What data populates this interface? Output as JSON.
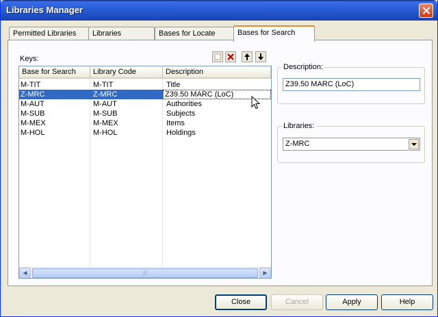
{
  "window": {
    "title": "Libraries Manager"
  },
  "tabs": [
    {
      "label": "Permitted Libraries",
      "active": false
    },
    {
      "label": "Libraries",
      "active": false
    },
    {
      "label": "Bases for Locate",
      "active": false
    },
    {
      "label": "Bases for Search",
      "active": true
    }
  ],
  "keys": {
    "label": "Keys:",
    "toolbar": [
      "new-icon",
      "delete-icon",
      "move-up-icon",
      "move-down-icon"
    ],
    "columns": [
      "Base for Search",
      "Library Code",
      "Description"
    ],
    "rows": [
      {
        "base": "M-TIT",
        "code": "M-TIT",
        "desc": "Title",
        "selected": false
      },
      {
        "base": "Z-MRC",
        "code": "Z-MRC",
        "desc": "Z39.50 MARC (LoC)",
        "selected": true
      },
      {
        "base": "M-AUT",
        "code": "M-AUT",
        "desc": "Authorities",
        "selected": false
      },
      {
        "base": "M-SUB",
        "code": "M-SUB",
        "desc": "Subjects",
        "selected": false
      },
      {
        "base": "M-MEX",
        "code": "M-MEX",
        "desc": "Items",
        "selected": false
      },
      {
        "base": "M-HOL",
        "code": "M-HOL",
        "desc": "Holdings",
        "selected": false
      }
    ]
  },
  "description": {
    "label": "Description:",
    "value": "Z39.50 MARC (LoC)"
  },
  "libraries": {
    "label": "Libraries:",
    "value": "Z-MRC"
  },
  "buttons": {
    "close": "Close",
    "cancel": "Cancel",
    "apply": "Apply",
    "help": "Help"
  },
  "colors": {
    "selection": "#316ac5",
    "titlebar": "#2b5fd9",
    "face": "#ece9d8"
  }
}
